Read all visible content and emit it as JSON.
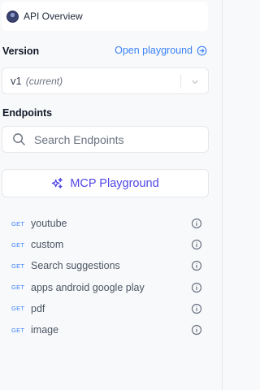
{
  "overview": {
    "label": "API Overview",
    "icon": "avatar"
  },
  "version": {
    "label": "Version",
    "playground_link": "Open playground",
    "selected": "v1",
    "selected_tag": "(current)"
  },
  "endpoints": {
    "label": "Endpoints",
    "search_placeholder": "Search Endpoints",
    "mcp_button": "MCP Playground",
    "items": [
      {
        "method": "GET",
        "name": "youtube"
      },
      {
        "method": "GET",
        "name": "custom"
      },
      {
        "method": "GET",
        "name": "Search suggestions"
      },
      {
        "method": "GET",
        "name": "apps android google play"
      },
      {
        "method": "GET",
        "name": "pdf"
      },
      {
        "method": "GET",
        "name": "image"
      }
    ]
  },
  "colors": {
    "link": "#3b82f6",
    "mcp_accent": "#4f46e5",
    "method": "#3b82f6",
    "background": "#f8f9fb"
  }
}
